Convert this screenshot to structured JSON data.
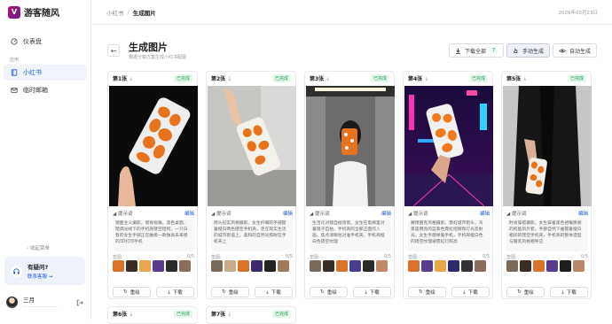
{
  "app": {
    "name": "游客随风"
  },
  "sidebar": {
    "dashboard": "仪表盘",
    "section": "应用",
    "items": [
      {
        "label": "小红书"
      },
      {
        "label": "临时邮箱"
      }
    ],
    "collapse": "收起菜单",
    "help_title": "有疑问?",
    "help_link": "联系客服 →",
    "user_name": "三月",
    "user_id": "····································"
  },
  "topbar": {
    "crumb1": "小红书",
    "crumb2": "生成图片",
    "date": "2026年03月23日"
  },
  "page": {
    "title": "生成图片",
    "subtitle": "根据分镜方案生成小红书配图"
  },
  "actions": {
    "download_all": "下载全部",
    "download_count": "7",
    "manual": "手动生成",
    "auto": "自动生成"
  },
  "cards": [
    {
      "title": "第1张",
      "status": "已完成",
      "prompt_label": "提示词",
      "edit": "编辑",
      "prompt": "镜面主义摄影，俯视视角。黑色桌面，暗调光线下的手机壳镂空结构，一只白皙的女生手部正在触摸一款独具未来感的3D打印手机",
      "ref_label": "垫图:",
      "ref_count": "0/5",
      "regen": "重绘",
      "download": "下载"
    },
    {
      "title": "第2张",
      "status": "已完成",
      "prompt_label": "提示词",
      "edit": "编辑",
      "prompt": "街头纪实风格摄影。女生纤细的手部握着橙白两色镂空手机壳，走在现实生活的城市街道上，柔和的自然光照射在手机壳上",
      "ref_label": "垫图:",
      "ref_count": "0/5",
      "regen": "重绘",
      "download": "下载"
    },
    {
      "title": "第3张",
      "status": "已完成",
      "prompt_label": "提示词",
      "edit": "编辑",
      "prompt": "生活化对镜自拍场景。女生在电梯里对着镜子自拍，手机壳的全部正面均入画，焦点清晰地对准手机壳，手机壳橙白色镂空纹理",
      "ref_label": "垫图:",
      "ref_count": "0/5",
      "regen": "重绘",
      "download": "下载"
    },
    {
      "title": "第4张",
      "status": "已完成",
      "prompt_label": "提示词",
      "edit": "编辑",
      "prompt": "赛博朋克风格摄影。霓虹城市街头，背景是明亮的蓝紫色霓虹招牌和灯光反射光，女生手部举着手机，手机壳橙白色的镂空纹理被霓虹灯照亮",
      "ref_label": "垫图:",
      "ref_count": "0/5",
      "regen": "重绘",
      "download": "下载"
    },
    {
      "title": "第5张",
      "status": "已完成",
      "prompt_label": "提示词",
      "edit": "编辑",
      "prompt": "时尚穿搭摄影。女生穿着黑色褶皱质感的机能风外套，手部自然下垂握着橙白相间的镂空手机壳，手机壳的整体造型与服装风格相呼应",
      "ref_label": "垫图:",
      "ref_count": "0/5",
      "regen": "重绘",
      "download": "下载"
    }
  ],
  "cards_row2": [
    {
      "title": "第6张",
      "status": "已完成"
    },
    {
      "title": "第7张",
      "status": "已完成"
    }
  ]
}
